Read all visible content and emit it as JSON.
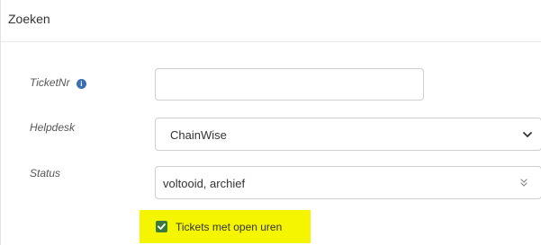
{
  "panel": {
    "title": "Zoeken"
  },
  "fields": {
    "ticketnr": {
      "label": "TicketNr",
      "info_icon": "info-icon",
      "value": ""
    },
    "helpdesk": {
      "label": "Helpdesk",
      "value": "ChainWise",
      "icon": "chevron-down-icon"
    },
    "status": {
      "label": "Status",
      "value": "voltooid, archief",
      "icon": "double-chevron-icon"
    }
  },
  "filter": {
    "open_hours_label": "Tickets met open uren",
    "checked": true,
    "highlight_color": "#f5f500",
    "checkbox_color": "#3c7a3c"
  }
}
